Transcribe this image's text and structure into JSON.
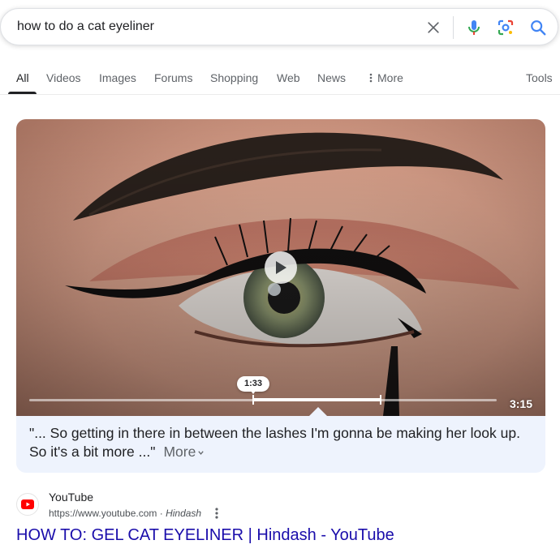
{
  "search": {
    "query": "how to do a cat eyeliner"
  },
  "icons": {
    "clear": "close-icon",
    "voice": "mic-icon",
    "lens": "lens-icon",
    "search": "search-icon"
  },
  "tabs": [
    {
      "label": "All",
      "active": true
    },
    {
      "label": "Videos"
    },
    {
      "label": "Images"
    },
    {
      "label": "Forums"
    },
    {
      "label": "Shopping"
    },
    {
      "label": "Web"
    },
    {
      "label": "News"
    },
    {
      "label": "More"
    },
    {
      "label": "Tools"
    }
  ],
  "video": {
    "timestamp": "1:33",
    "duration": "3:15",
    "progress_fraction": 0.475,
    "snippet": "\"... So getting in there in between the lashes I'm gonna be making her look up. So it's a bit more ...\"",
    "more_label": "More"
  },
  "result": {
    "source_name": "YouTube",
    "url": "https://www.youtube.com",
    "separator": " · ",
    "author": "Hindash",
    "title": "HOW TO: GEL CAT EYELINER | Hindash - YouTube"
  },
  "colors": {
    "accent_blue": "#1a73e8",
    "link": "#1a0dab",
    "youtube_red": "#ff0000"
  }
}
